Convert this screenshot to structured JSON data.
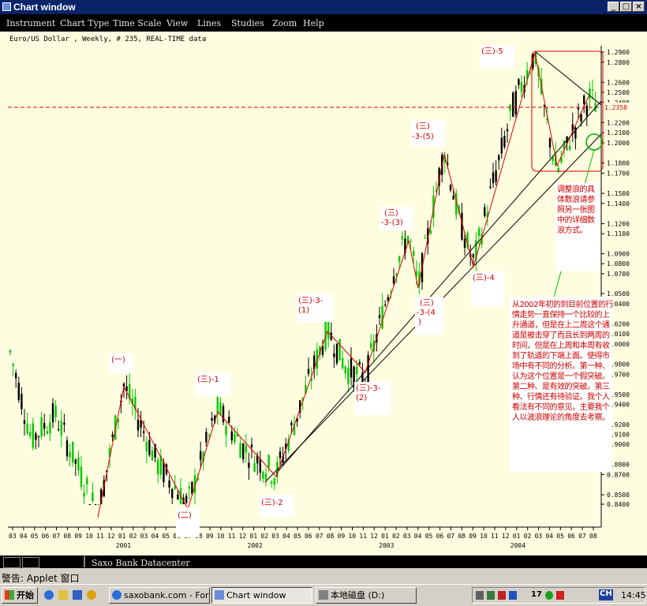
{
  "window": {
    "title": "Chart window",
    "buttons": [
      "_",
      "□",
      "×"
    ]
  },
  "menu": [
    "Instrument",
    "Chart Type",
    "Time Scale",
    "View",
    "Lines",
    "Studies",
    "Zoom",
    "Help"
  ],
  "chart": {
    "header": "Euro/US Dollar , Weekly, # 235, REAL-TIME data",
    "price_labels": [
      "1.2900",
      "1.2800",
      "1.2600",
      "1.2500",
      "1.2400",
      "1.2200",
      "1.2100",
      "1.2000",
      "1.1800",
      "1.1700",
      "1.1500",
      "1.1400",
      "1.1200",
      "1.1100",
      "1.0900",
      "1.0800",
      "1.0700",
      "1.0500",
      "1.0400",
      "1.0200",
      "1.0100",
      "1.0000",
      "0.9800",
      "0.9700",
      "0.9500",
      "0.9400",
      "0.9200",
      "0.9100",
      "0.9000",
      "0.8800",
      "0.8700",
      "0.8500",
      "0.8400"
    ],
    "current_price": "1.2358",
    "month_labels": [
      "03",
      "04",
      "05",
      "06",
      "07",
      "08",
      "09",
      "10",
      "11",
      "12",
      "01",
      "02",
      "03",
      "04",
      "05",
      "06",
      "07",
      "08",
      "09",
      "10",
      "11",
      "12",
      "01",
      "02",
      "03",
      "04",
      "05",
      "06",
      "07",
      "08",
      "09",
      "10",
      "11",
      "12",
      "01",
      "02",
      "03",
      "04",
      "05",
      "06",
      "07",
      "08",
      "09",
      "10",
      "11",
      "12",
      "01",
      "02",
      "03",
      "04",
      "05",
      "06",
      "07",
      "08"
    ],
    "year_labels": [
      "2001",
      "2002",
      "2003",
      "2004"
    ],
    "annotations": [
      "(一)",
      "(二)",
      "(三)-1",
      "(三)-2",
      "(三)-3-",
      "(1)",
      "(三)-3-",
      "(2)",
      "(三)",
      "-3-(3)",
      "(三)",
      "-3-(4",
      ")",
      "(三)",
      "-3-(5)",
      "(三)-4",
      "(三)-5"
    ],
    "note_top": "调整浪的具体数浪请参照另一张图中的详细数浪方式。",
    "note_bottom": "从2002年初的到目前位置的行情走势一直保持一个比较的上升通道，但是在上二周这个通道是被击穿了而且长到两周的时间，但是在上周和本周有收到了轨道的下端上面。使得市场中有不同的分析。第一种、认为这个位置是一个假突破。第二种、是有效的突破。第三种、行情还有待验证。我个人看法有不同的意见，主要我个人以波浪理论的角度去考察。",
    "colors": {
      "bg": "#fffde0",
      "bull": "#00c800",
      "bear": "#000000",
      "wave": "#ff0000",
      "annot": "#cc0000",
      "channel": "#000000"
    }
  },
  "status": {
    "text": "Saxo Bank Datacenter"
  },
  "warning": {
    "text": "警告: Applet 窗口"
  },
  "taskbar": {
    "start": "开始",
    "tasks": [
      "saxobank.com - Forex - ...",
      "Chart window",
      "本地磁盘 (D:)"
    ],
    "tray_text": "17",
    "lang": "CH",
    "clock": "14:45"
  }
}
